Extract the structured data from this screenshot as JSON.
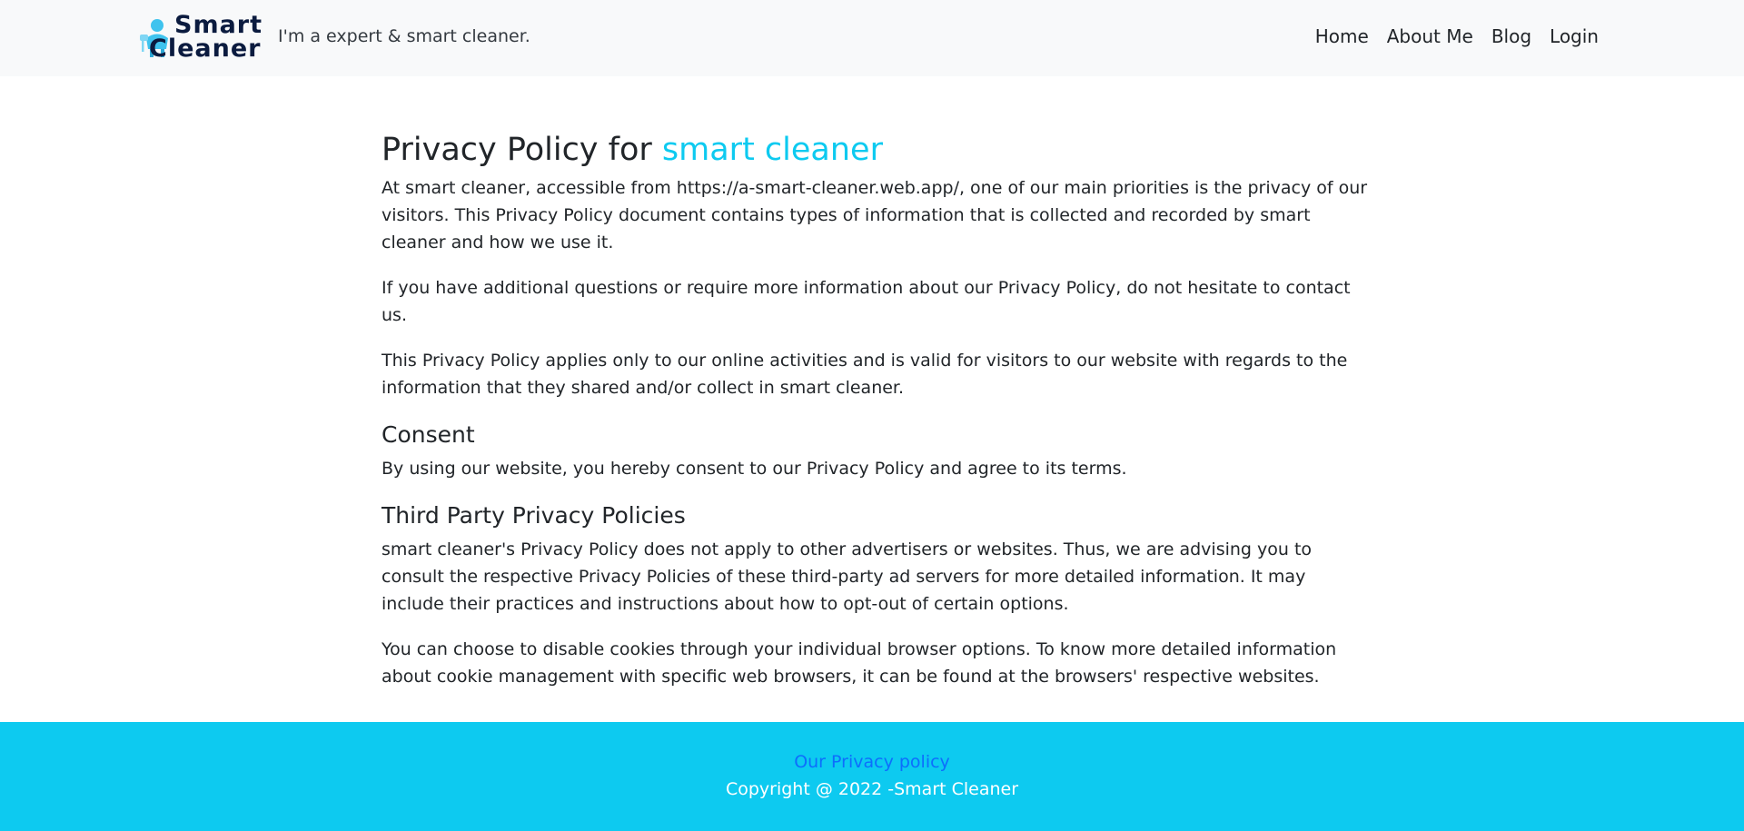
{
  "header": {
    "brand_line1": "Smart",
    "brand_line2": "Cleaner",
    "tagline": "I'm a expert & smart cleaner.",
    "nav": [
      {
        "label": "Home"
      },
      {
        "label": "About Me"
      },
      {
        "label": "Blog"
      },
      {
        "label": "Login"
      }
    ]
  },
  "main": {
    "title_prefix": "Privacy Policy for ",
    "title_accent": "smart cleaner",
    "paragraphs": [
      "At smart cleaner, accessible from https://a-smart-cleaner.web.app/, one of our main priorities is the privacy of our visitors. This Privacy Policy document contains types of information that is collected and recorded by smart cleaner and how we use it.",
      "If you have additional questions or require more information about our Privacy Policy, do not hesitate to contact us.",
      "This Privacy Policy applies only to our online activities and is valid for visitors to our website with regards to the information that they shared and/or collect in smart cleaner."
    ],
    "consent": {
      "heading": "Consent",
      "text": "By using our website, you hereby consent to our Privacy Policy and agree to its terms."
    },
    "third_party": {
      "heading": "Third Party Privacy Policies",
      "paragraphs": [
        "smart cleaner's Privacy Policy does not apply to other advertisers or websites. Thus, we are advising you to consult the respective Privacy Policies of these third-party ad servers for more detailed information. It may include their practices and instructions about how to opt-out of certain options.",
        "You can choose to disable cookies through your individual browser options. To know more detailed information about cookie management with specific web browsers, it can be found at the browsers' respective websites."
      ]
    }
  },
  "footer": {
    "link": "Our Privacy policy",
    "copyright": "Copyright @ 2022 -Smart Cleaner"
  },
  "colors": {
    "accent": "#0dcaf0",
    "footer_link": "#0d6efd",
    "navbar_bg": "#f8f9fa",
    "brand_dark": "#0b1b3f"
  },
  "icons": {
    "logo": "cleaner-person-icon"
  }
}
